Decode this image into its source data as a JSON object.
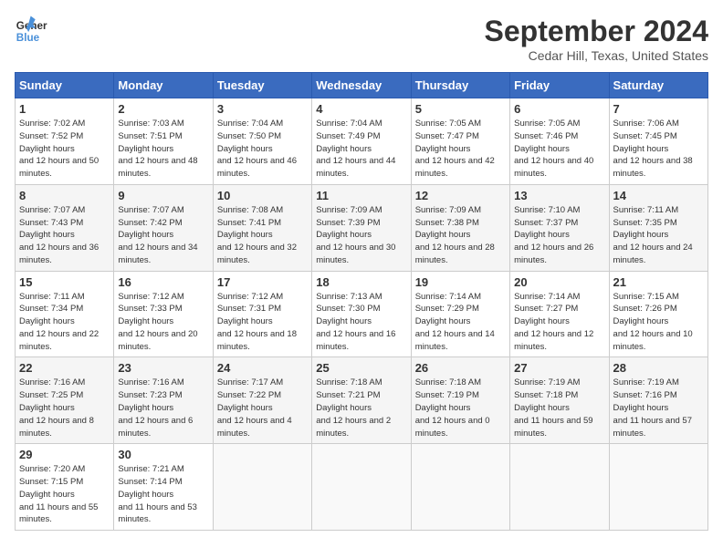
{
  "header": {
    "logo_line1": "General",
    "logo_line2": "Blue",
    "month": "September 2024",
    "location": "Cedar Hill, Texas, United States"
  },
  "weekdays": [
    "Sunday",
    "Monday",
    "Tuesday",
    "Wednesday",
    "Thursday",
    "Friday",
    "Saturday"
  ],
  "weeks": [
    [
      {
        "day": "1",
        "sunrise": "7:02 AM",
        "sunset": "7:52 PM",
        "daylight": "12 hours and 50 minutes."
      },
      {
        "day": "2",
        "sunrise": "7:03 AM",
        "sunset": "7:51 PM",
        "daylight": "12 hours and 48 minutes."
      },
      {
        "day": "3",
        "sunrise": "7:04 AM",
        "sunset": "7:50 PM",
        "daylight": "12 hours and 46 minutes."
      },
      {
        "day": "4",
        "sunrise": "7:04 AM",
        "sunset": "7:49 PM",
        "daylight": "12 hours and 44 minutes."
      },
      {
        "day": "5",
        "sunrise": "7:05 AM",
        "sunset": "7:47 PM",
        "daylight": "12 hours and 42 minutes."
      },
      {
        "day": "6",
        "sunrise": "7:05 AM",
        "sunset": "7:46 PM",
        "daylight": "12 hours and 40 minutes."
      },
      {
        "day": "7",
        "sunrise": "7:06 AM",
        "sunset": "7:45 PM",
        "daylight": "12 hours and 38 minutes."
      }
    ],
    [
      {
        "day": "8",
        "sunrise": "7:07 AM",
        "sunset": "7:43 PM",
        "daylight": "12 hours and 36 minutes."
      },
      {
        "day": "9",
        "sunrise": "7:07 AM",
        "sunset": "7:42 PM",
        "daylight": "12 hours and 34 minutes."
      },
      {
        "day": "10",
        "sunrise": "7:08 AM",
        "sunset": "7:41 PM",
        "daylight": "12 hours and 32 minutes."
      },
      {
        "day": "11",
        "sunrise": "7:09 AM",
        "sunset": "7:39 PM",
        "daylight": "12 hours and 30 minutes."
      },
      {
        "day": "12",
        "sunrise": "7:09 AM",
        "sunset": "7:38 PM",
        "daylight": "12 hours and 28 minutes."
      },
      {
        "day": "13",
        "sunrise": "7:10 AM",
        "sunset": "7:37 PM",
        "daylight": "12 hours and 26 minutes."
      },
      {
        "day": "14",
        "sunrise": "7:11 AM",
        "sunset": "7:35 PM",
        "daylight": "12 hours and 24 minutes."
      }
    ],
    [
      {
        "day": "15",
        "sunrise": "7:11 AM",
        "sunset": "7:34 PM",
        "daylight": "12 hours and 22 minutes."
      },
      {
        "day": "16",
        "sunrise": "7:12 AM",
        "sunset": "7:33 PM",
        "daylight": "12 hours and 20 minutes."
      },
      {
        "day": "17",
        "sunrise": "7:12 AM",
        "sunset": "7:31 PM",
        "daylight": "12 hours and 18 minutes."
      },
      {
        "day": "18",
        "sunrise": "7:13 AM",
        "sunset": "7:30 PM",
        "daylight": "12 hours and 16 minutes."
      },
      {
        "day": "19",
        "sunrise": "7:14 AM",
        "sunset": "7:29 PM",
        "daylight": "12 hours and 14 minutes."
      },
      {
        "day": "20",
        "sunrise": "7:14 AM",
        "sunset": "7:27 PM",
        "daylight": "12 hours and 12 minutes."
      },
      {
        "day": "21",
        "sunrise": "7:15 AM",
        "sunset": "7:26 PM",
        "daylight": "12 hours and 10 minutes."
      }
    ],
    [
      {
        "day": "22",
        "sunrise": "7:16 AM",
        "sunset": "7:25 PM",
        "daylight": "12 hours and 8 minutes."
      },
      {
        "day": "23",
        "sunrise": "7:16 AM",
        "sunset": "7:23 PM",
        "daylight": "12 hours and 6 minutes."
      },
      {
        "day": "24",
        "sunrise": "7:17 AM",
        "sunset": "7:22 PM",
        "daylight": "12 hours and 4 minutes."
      },
      {
        "day": "25",
        "sunrise": "7:18 AM",
        "sunset": "7:21 PM",
        "daylight": "12 hours and 2 minutes."
      },
      {
        "day": "26",
        "sunrise": "7:18 AM",
        "sunset": "7:19 PM",
        "daylight": "12 hours and 0 minutes."
      },
      {
        "day": "27",
        "sunrise": "7:19 AM",
        "sunset": "7:18 PM",
        "daylight": "11 hours and 59 minutes."
      },
      {
        "day": "28",
        "sunrise": "7:19 AM",
        "sunset": "7:16 PM",
        "daylight": "11 hours and 57 minutes."
      }
    ],
    [
      {
        "day": "29",
        "sunrise": "7:20 AM",
        "sunset": "7:15 PM",
        "daylight": "11 hours and 55 minutes."
      },
      {
        "day": "30",
        "sunrise": "7:21 AM",
        "sunset": "7:14 PM",
        "daylight": "11 hours and 53 minutes."
      },
      null,
      null,
      null,
      null,
      null
    ]
  ]
}
